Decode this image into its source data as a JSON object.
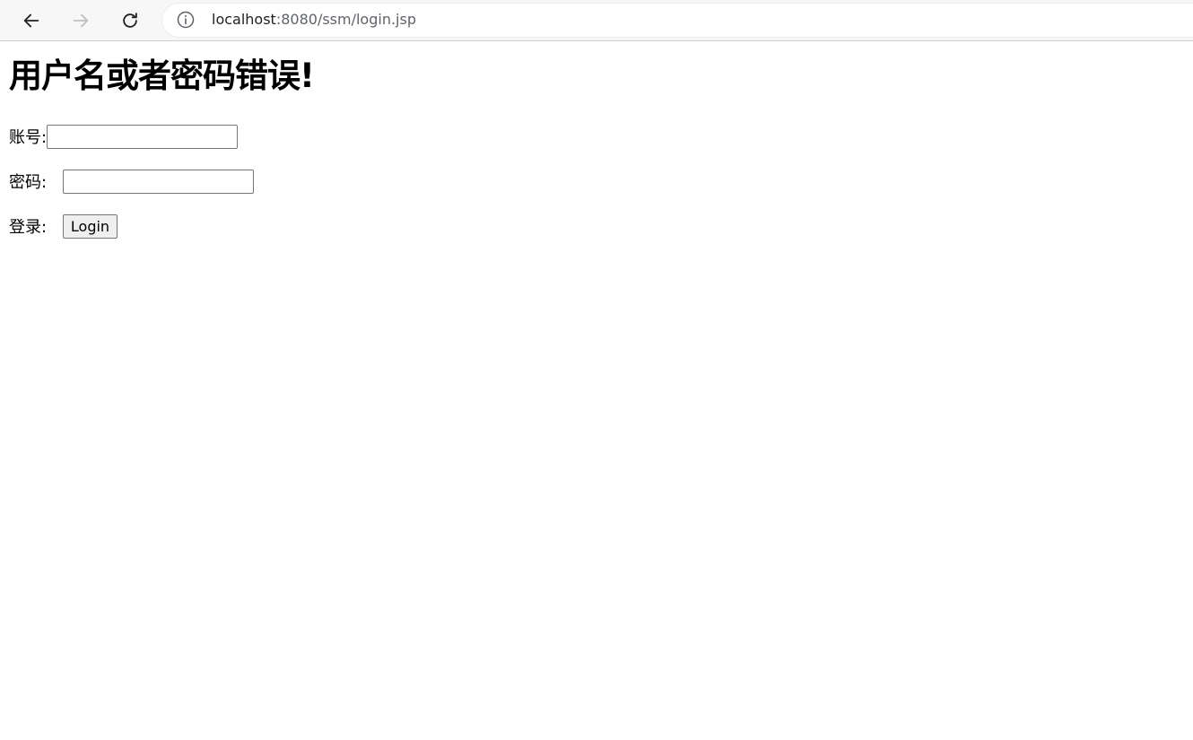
{
  "browser": {
    "url_host": "localhost",
    "url_rest": ":8080/ssm/login.jsp",
    "icons": {
      "back": "arrow-left",
      "forward": "arrow-right",
      "reload": "reload",
      "info": "info-circle"
    }
  },
  "page": {
    "heading": "用户名或者密码错误!",
    "form": {
      "account_label": "账号:",
      "account_value": "",
      "password_label": "密码:",
      "password_value": "",
      "login_label": "登录:",
      "login_button": "Login"
    }
  }
}
